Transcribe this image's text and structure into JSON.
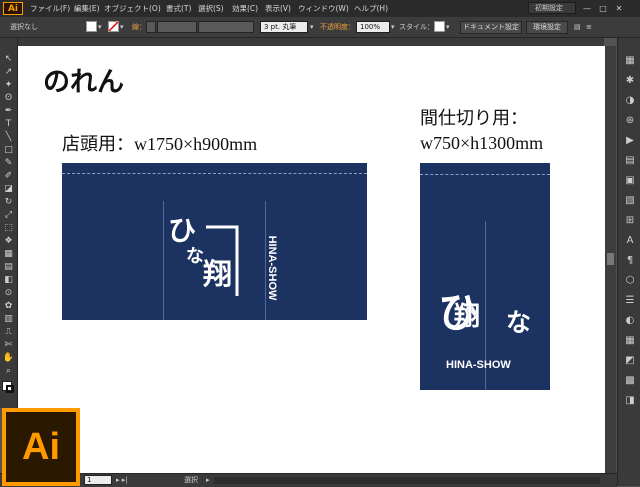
{
  "app": {
    "logo_text": "Ai",
    "workspace": "初期設定"
  },
  "menu": [
    "ファイル(F)",
    "編集(E)",
    "オブジェクト(O)",
    "書式(T)",
    "選択(S)",
    "効果(C)",
    "表示(V)",
    "ウィンドウ(W)",
    "ヘルプ(H)"
  ],
  "window_controls": [
    "—",
    "□",
    "✕"
  ],
  "control_bar": {
    "selection": "選択なし",
    "stroke_label": "線：",
    "brush": "3 pt. 丸筆",
    "opacity_label": "不透明度：",
    "opacity": "100%",
    "style_label": "スタイル：",
    "doc_setup": "ドキュメント設定",
    "preferences": "環境設定"
  },
  "tools": [
    "↖",
    "↗",
    "✦",
    "ʘ",
    "✒",
    "T",
    "╲",
    "□",
    "✎",
    "✐",
    "◪",
    "↻",
    "⤢",
    "⬚",
    "❖",
    "▦",
    "▤",
    "◧",
    "⊙",
    "✿",
    "▥",
    "⎍",
    "✄",
    "✋",
    "⌕"
  ],
  "right_icons": [
    "▦",
    "✱",
    "◑",
    "⊛",
    "▶",
    "▤",
    "▣",
    "▧",
    "⊞",
    "A",
    "¶",
    "⬡",
    "☰",
    "◐",
    "▦",
    "◩",
    "▩",
    "◨"
  ],
  "canvas": {
    "title": "のれん",
    "store": {
      "heading": "店頭用：w1750×h900mm",
      "brand_hira1": "ひ",
      "brand_hira2": "な",
      "brand_kanji": "翔",
      "brand_roman": "HINA-SHOW"
    },
    "partition": {
      "heading_line1": "間仕切り用：",
      "heading_line2": "w750×h1300mm",
      "brand_hira1": "ひ",
      "brand_kanji": "翔",
      "brand_hira2": "な",
      "brand_roman": "HINA-SHOW"
    }
  },
  "statusbar": {
    "zoom": "1",
    "tool": "選択"
  },
  "colors": {
    "noren": "#1c3260",
    "accent": "#ff9a00",
    "chrome": "#3a3a3a"
  }
}
